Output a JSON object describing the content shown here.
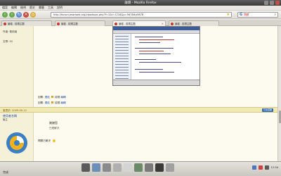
{
  "window": {
    "title": "論壇 - Mozilla Firefox"
  },
  "menu": {
    "items": [
      "檔案",
      "編輯",
      "檢視",
      "歷史",
      "書籤",
      "工具",
      "說明"
    ]
  },
  "nav": {
    "url": "http://forum.example.org/viewtopic.php?f=1&t=1234&p=5678#p5678",
    "search_query": "問題"
  },
  "tabs": [
    {
      "label": "論壇 - 檢視主題"
    },
    {
      "label": "論壇 - 檢視主題"
    },
    {
      "label": "論壇 - 檢視主題"
    },
    {
      "label": "論壇 - 檢視主題"
    }
  ],
  "content": {
    "left_label_1": "作者: 使用者",
    "left_label_2": "文章: 52",
    "link_row_1": {
      "prefix": "回覆:",
      "link": "連結",
      "suffix": "檢視",
      "edit": "編輯"
    },
    "link_row_2": {
      "prefix": "回覆:",
      "link": "連結",
      "suffix": "檢視",
      "edit": "編輯"
    },
    "post_date": "發表於: 2009-05-12",
    "quote_label": "引言回覆",
    "username": "使用者名稱",
    "user_rank": "版主",
    "reply_line_1": "謝謝您",
    "reply_line_2": "已經解決",
    "reply_line_3": "問題已解決"
  },
  "statusbar": {
    "text": "完成"
  },
  "tray": {
    "clock": "12:34"
  },
  "colors": {
    "accent": "#1a4c9c",
    "post_bar": "#f1e9b4"
  }
}
